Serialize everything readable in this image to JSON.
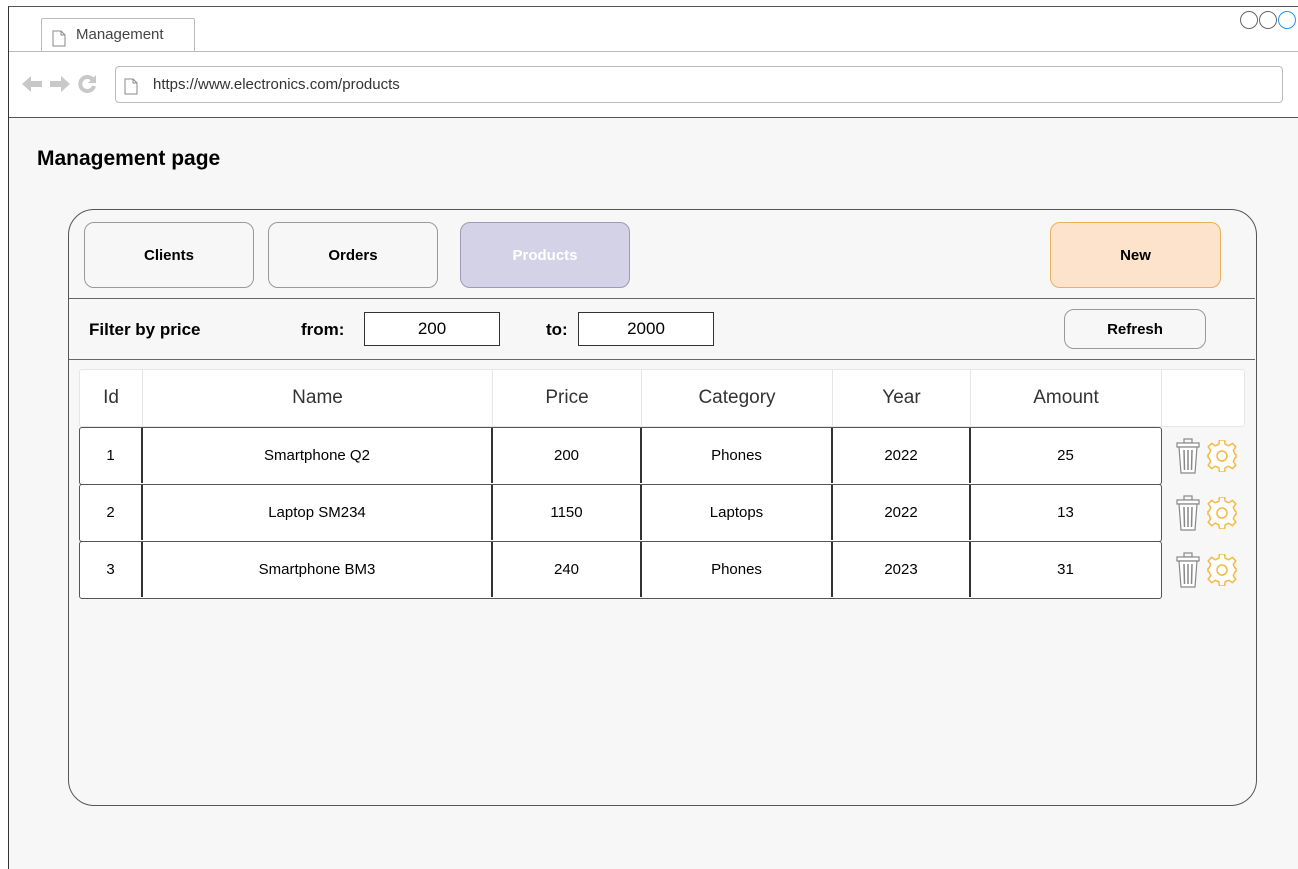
{
  "browser": {
    "tab_title": "Management",
    "url": "https://www.electronics.com/products",
    "nav_icons": [
      "back-arrow-icon",
      "forward-arrow-icon",
      "reload-icon"
    ]
  },
  "page": {
    "title": "Management page"
  },
  "toolbar": {
    "clients_label": "Clients",
    "orders_label": "Orders",
    "products_label": "Products",
    "new_label": "New",
    "active_tab": "Products"
  },
  "filter": {
    "label": "Filter by price",
    "from_label": "from:",
    "from_value": "200",
    "to_label": "to:",
    "to_value": "2000",
    "refresh_label": "Refresh"
  },
  "table": {
    "columns": [
      "Id",
      "Name",
      "Price",
      "Category",
      "Year",
      "Amount"
    ],
    "rows": [
      {
        "id": "1",
        "name": "Smartphone Q2",
        "price": "200",
        "category": "Phones",
        "year": "2022",
        "amount": "25"
      },
      {
        "id": "2",
        "name": "Laptop SM234",
        "price": "1150",
        "category": "Laptops",
        "year": "2022",
        "amount": "13"
      },
      {
        "id": "3",
        "name": "Smartphone BM3",
        "price": "240",
        "category": "Phones",
        "year": "2023",
        "amount": "31"
      }
    ],
    "row_action_icons": [
      "trash-icon",
      "gear-icon"
    ]
  },
  "colors": {
    "products_active_bg": "#d4d2e6",
    "new_button_bg": "#fde3cb",
    "new_button_border": "#e8b25a",
    "gear_icon": "#f5b942",
    "trash_icon": "#888888"
  }
}
